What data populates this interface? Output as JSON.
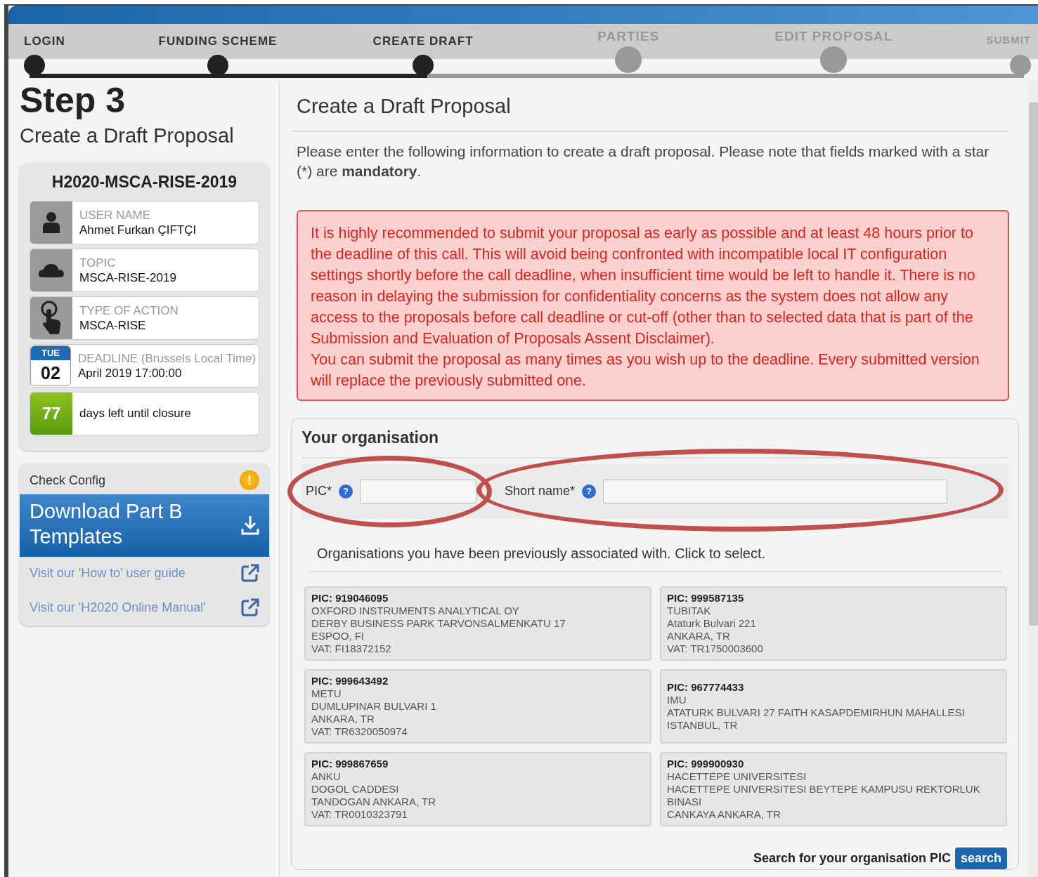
{
  "steps": [
    {
      "label": "LOGIN",
      "completed": true
    },
    {
      "label": "FUNDING SCHEME",
      "completed": true
    },
    {
      "label": "CREATE DRAFT",
      "completed": true
    },
    {
      "label": "PARTIES",
      "completed": false
    },
    {
      "label": "EDIT PROPOSAL",
      "completed": false
    },
    {
      "label": "SUBMIT",
      "completed": false
    }
  ],
  "sidebar": {
    "step_title": "Step 3",
    "step_subtitle": "Create a Draft Proposal",
    "call_id": "H2020-MSCA-RISE-2019",
    "info": [
      {
        "kind": "user",
        "label": "USER NAME",
        "value": "Ahmet Furkan ÇIFTÇI"
      },
      {
        "kind": "topic",
        "label": "TOPIC",
        "value": "MSCA-RISE-2019"
      },
      {
        "kind": "action",
        "label": "TYPE OF ACTION",
        "value": "MSCA-RISE"
      },
      {
        "kind": "deadline",
        "weekday": "TUE",
        "day": "02",
        "label": "DEADLINE (Brussels Local Time)",
        "value": "April 2019 17:00:00"
      },
      {
        "kind": "countdown",
        "count": "77",
        "value": "days left until closure"
      }
    ],
    "check_config": "Check Config",
    "check_config_icon": "!",
    "download": "Download Part B Templates",
    "links": [
      "Visit our 'How to' user guide",
      "Visit our 'H2020 Online Manual'"
    ]
  },
  "main": {
    "title": "Create a Draft Proposal",
    "intro": "Please enter the following information to create a draft proposal. Please note that fields marked with a star (*) are **mandatory**.",
    "alert": [
      "It is highly recommended to submit your proposal as early as possible and at least 48 hours prior to the deadline of this call. This will avoid being confronted with incompatible local IT configuration settings shortly before the call deadline, when insufficient time would be left to handle it. There is no reason in delaying the submission for confidentiality concerns as the system does not allow any access to the proposals before call deadline or cut-off (other than to selected data that is part of the Submission and Evaluation of Proposals Assent Disclaimer).",
      "You can submit the proposal as many times as you wish up to the deadline. Every submitted version will replace the previously submitted one."
    ],
    "organisation": {
      "title": "Your organisation",
      "fields": [
        {
          "label": "PIC*",
          "help": "?",
          "highlighted": true
        },
        {
          "label": "Short name*",
          "help": "?",
          "highlighted": true
        }
      ],
      "previous_title": "Organisations you have been previously associated with. Click to select.",
      "previous": [
        {
          "pic": "PIC: 919046095",
          "lines": [
            "OXFORD INSTRUMENTS ANALYTICAL OY",
            "DERBY BUSINESS PARK TARVONSALMENKATU 17",
            "ESPOO, FI",
            "VAT: FI18372152"
          ]
        },
        {
          "pic": "PIC: 999587135",
          "lines": [
            "TUBITAK",
            "Ataturk Bulvari 221",
            "ANKARA, TR",
            "VAT: TR1750003600"
          ]
        },
        {
          "pic": "PIC: 999643492",
          "lines": [
            "METU",
            "DUMLUPINAR BULVARI 1",
            "ANKARA, TR",
            "VAT: TR6320050974"
          ]
        },
        {
          "pic": "PIC: 967774433",
          "lines": [
            "IMU",
            "ATATURK BULVARI 27 FAITH KASAPDEMIRHUN MAHALLESI",
            "ISTANBUL, TR"
          ]
        },
        {
          "pic": "PIC: 999867659",
          "lines": [
            "ANKU",
            "DOGOL CADDESI",
            "TANDOGAN ANKARA, TR",
            "VAT: TR0010323791"
          ]
        },
        {
          "pic": "PIC: 999900930",
          "lines": [
            "HACETTEPE UNIVERSITESI",
            "HACETTEPE UNIVERSITESI BEYTEPE KAMPUSU REKTORLUK BINASI",
            "CANKAYA ANKARA, TR"
          ]
        }
      ],
      "search_label": "Search for your organisation PIC",
      "search_button": "search"
    }
  }
}
